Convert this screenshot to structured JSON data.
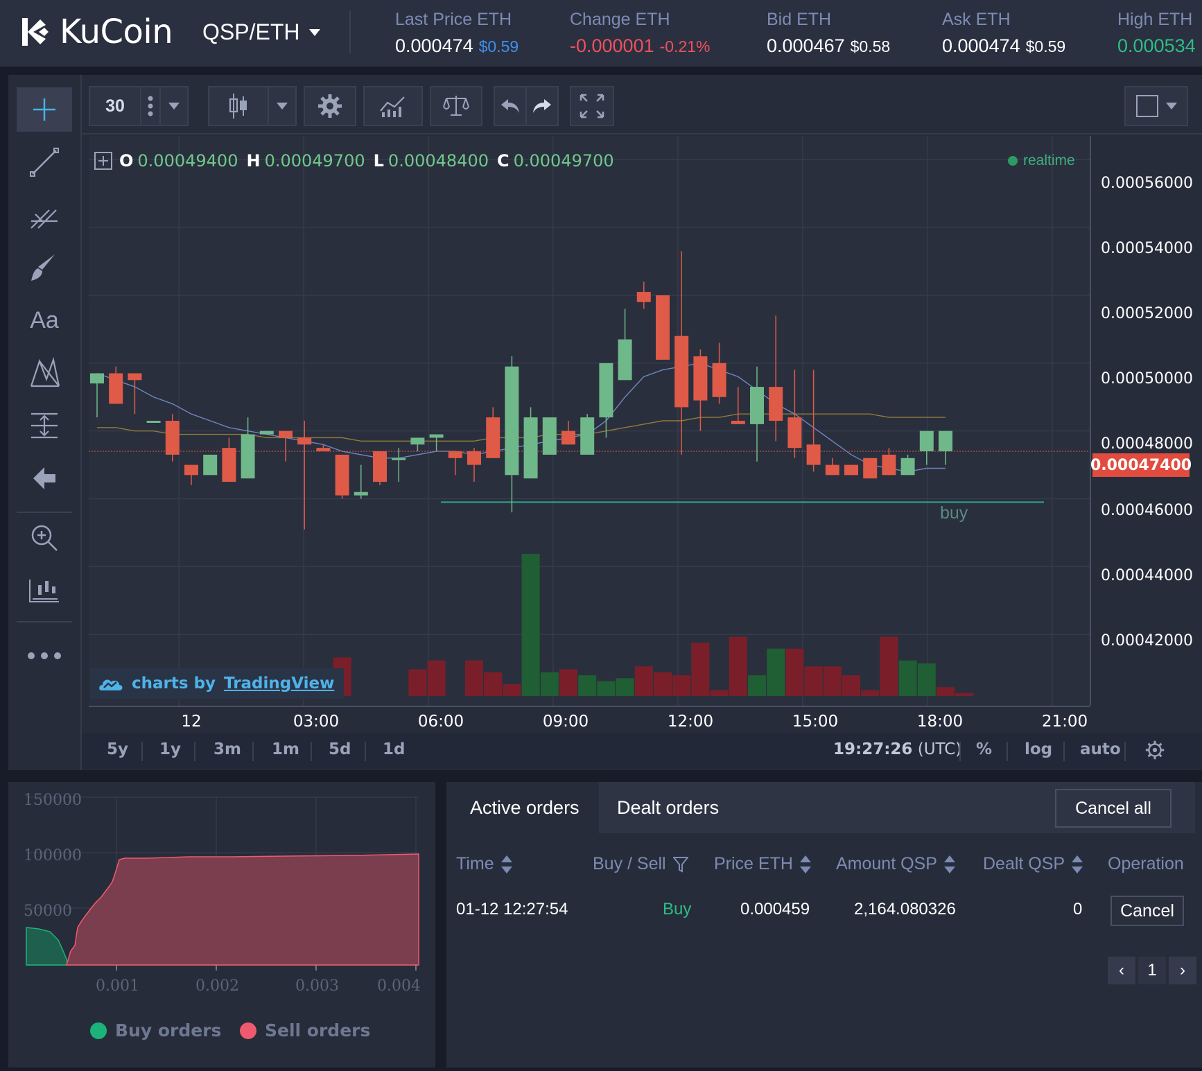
{
  "header": {
    "logo_text": "KuCoin",
    "pair": "QSP/ETH",
    "stats": [
      {
        "label": "Last Price ETH",
        "value": "0.000474",
        "usd": "$0.59",
        "value_color": "#ffffff",
        "usd_color": "#3f8ff0"
      },
      {
        "label": "Change ETH",
        "value": "-0.000001",
        "usd": "-0.21%",
        "value_color": "#f0505c",
        "usd_color": "#f0505c"
      },
      {
        "label": "Bid ETH",
        "value": "0.000467",
        "usd": "$0.58",
        "value_color": "#ffffff",
        "usd_color": "#ffffff"
      },
      {
        "label": "Ask ETH",
        "value": "0.000474",
        "usd": "$0.59",
        "value_color": "#ffffff",
        "usd_color": "#ffffff"
      },
      {
        "label": "High ETH",
        "value": "0.000534",
        "usd": "",
        "value_color": "#2dbd85",
        "usd_color": "#2dbd85"
      }
    ]
  },
  "toolbar": {
    "interval": "30",
    "left_tools": [
      "crosshair-icon",
      "trend-line-icon",
      "fib-icon",
      "brush-icon",
      "text-icon",
      "pattern-icon",
      "measure-icon",
      "arrow-left-icon",
      "zoom-icon",
      "chart-bars-icon",
      "more-icon"
    ],
    "text_tool_label": "Aa"
  },
  "chart": {
    "ohlc": {
      "o_label": "O",
      "o": "0.00049400",
      "h_label": "H",
      "h": "0.00049700",
      "l_label": "L",
      "l": "0.00048400",
      "c_label": "C",
      "c": "0.00049700"
    },
    "realtime_label": "realtime",
    "tv_badge": {
      "prefix": "charts by",
      "link": "TradingView"
    },
    "buy_label": "buy",
    "current_price_label": "0.00047400",
    "price_ticks": [
      "0.00056000",
      "0.00054000",
      "0.00052000",
      "0.00050000",
      "0.00048000",
      "0.00046000",
      "0.00044000",
      "0.00042000"
    ],
    "time_ticks": [
      "12",
      "03:00",
      "06:00",
      "09:00",
      "12:00",
      "15:00",
      "18:00",
      "21:00"
    ],
    "colors": {
      "up": "#6fb88a",
      "down": "#e05a48",
      "vol_up": "#1f5f33",
      "vol_down": "#7a1f2a",
      "ma_fast": "#6f86c2",
      "ma_slow": "#8f7c3a"
    }
  },
  "chart_data": {
    "type": "candlestick",
    "title": "",
    "x": [
      "12",
      "03:00",
      "06:00",
      "09:00",
      "12:00",
      "15:00",
      "18:00",
      "21:00"
    ],
    "ylim": [
      0.0004,
      0.00057
    ],
    "candles": [
      [
        0.000494,
        0.000497,
        0.000484,
        0.000497
      ],
      [
        0.000497,
        0.000499,
        0.000488,
        0.000488
      ],
      [
        0.000497,
        0.000497,
        0.000485,
        0.000495
      ],
      [
        0.000483,
        0.000483,
        0.000483,
        0.000483
      ],
      [
        0.000483,
        0.000485,
        0.000471,
        0.000473
      ],
      [
        0.00047,
        0.00047,
        0.000464,
        0.000467
      ],
      [
        0.000467,
        0.000473,
        0.000467,
        0.000473
      ],
      [
        0.000475,
        0.000478,
        0.000465,
        0.000465
      ],
      [
        0.000466,
        0.000484,
        0.000466,
        0.000479
      ],
      [
        0.000479,
        0.00048,
        0.000479,
        0.00048
      ],
      [
        0.00048,
        0.00048,
        0.000471,
        0.000478
      ],
      [
        0.000478,
        0.000483,
        0.000451,
        0.000476
      ],
      [
        0.000475,
        0.000476,
        0.000474,
        0.000474
      ],
      [
        0.000473,
        0.000473,
        0.00046,
        0.000461
      ],
      [
        0.000461,
        0.00047,
        0.00046,
        0.000462
      ],
      [
        0.000474,
        0.000474,
        0.000464,
        0.000465
      ],
      [
        0.000472,
        0.000475,
        0.000465,
        0.000472
      ],
      [
        0.000476,
        0.000478,
        0.000474,
        0.000478
      ],
      [
        0.000478,
        0.000478,
        0.000474,
        0.000479
      ],
      [
        0.000474,
        0.000474,
        0.000467,
        0.000472
      ],
      [
        0.000474,
        0.000475,
        0.000465,
        0.00047
      ],
      [
        0.000484,
        0.000487,
        0.000472,
        0.000472
      ],
      [
        0.000467,
        0.000502,
        0.000456,
        0.000499
      ],
      [
        0.000466,
        0.000487,
        0.000466,
        0.000484
      ],
      [
        0.000473,
        0.000484,
        0.000473,
        0.000484
      ],
      [
        0.00048,
        0.000483,
        0.000476,
        0.000476
      ],
      [
        0.000473,
        0.000485,
        0.000473,
        0.000484
      ],
      [
        0.000484,
        0.000491,
        0.000478,
        0.0005
      ],
      [
        0.000495,
        0.000516,
        0.000495,
        0.000507
      ],
      [
        0.000521,
        0.000524,
        0.000516,
        0.000518
      ],
      [
        0.00052,
        0.00052,
        0.000501,
        0.000501
      ],
      [
        0.000508,
        0.000533,
        0.000473,
        0.000487
      ],
      [
        0.000502,
        0.000504,
        0.00048,
        0.000489
      ],
      [
        0.0005,
        0.000506,
        0.000488,
        0.00049
      ],
      [
        0.000483,
        0.000493,
        0.000482,
        0.000482
      ],
      [
        0.000482,
        0.000499,
        0.000471,
        0.000493
      ],
      [
        0.000493,
        0.000514,
        0.000477,
        0.000483
      ],
      [
        0.000484,
        0.000498,
        0.000472,
        0.000475
      ],
      [
        0.000476,
        0.000498,
        0.000468,
        0.00047
      ],
      [
        0.00047,
        0.000472,
        0.000467,
        0.000467
      ],
      [
        0.00047,
        0.00047,
        0.000467,
        0.000467
      ],
      [
        0.000472,
        0.000472,
        0.000466,
        0.000466
      ],
      [
        0.000473,
        0.000475,
        0.000467,
        0.000467
      ],
      [
        0.000467,
        0.000473,
        0.000467,
        0.000472
      ],
      [
        0.000474,
        0.00048,
        0.00047,
        0.00048
      ],
      [
        0.000474,
        0.00048,
        0.00047,
        0.00048
      ]
    ],
    "volume": [
      0,
      6,
      0,
      0,
      0,
      4,
      5,
      7,
      5,
      0,
      0,
      0,
      0,
      13,
      0,
      0,
      0,
      9,
      12,
      0,
      12,
      8,
      4,
      48,
      8,
      9,
      7,
      5,
      6,
      10,
      8,
      7,
      18,
      2,
      20,
      7,
      16,
      16,
      10,
      10,
      7,
      2,
      20,
      12,
      11,
      3,
      1
    ],
    "volume_up": [
      0,
      0,
      0,
      0,
      0,
      0,
      0,
      0,
      0,
      0,
      0,
      0,
      0,
      0,
      0,
      0,
      0,
      0,
      0,
      0,
      0,
      0,
      0,
      1,
      1,
      0,
      1,
      1,
      1,
      0,
      0,
      0,
      0,
      0,
      0,
      1,
      1,
      0,
      0,
      0,
      0,
      0,
      0,
      1,
      1,
      0,
      0
    ],
    "ma_fast": [
      0.000497,
      0.000495,
      0.000493,
      0.00049,
      0.000488,
      0.000485,
      0.000483,
      0.000481,
      0.00048,
      0.000479,
      0.000478,
      0.000477,
      0.000476,
      0.000474,
      0.000473,
      0.000472,
      0.000472,
      0.000473,
      0.000474,
      0.000474,
      0.000473,
      0.000474,
      0.000475,
      0.000476,
      0.000477,
      0.000478,
      0.000479,
      0.000483,
      0.00049,
      0.000496,
      0.000498,
      0.000499,
      0.0005,
      0.000498,
      0.000496,
      0.000492,
      0.000488,
      0.000485,
      0.000481,
      0.000477,
      0.000473,
      0.00047,
      0.000469,
      0.000468,
      0.000469,
      0.000469
    ],
    "ma_slow": [
      0.000481,
      0.000481,
      0.00048,
      0.00048,
      0.000479,
      0.000479,
      0.000479,
      0.000479,
      0.000479,
      0.000478,
      0.000478,
      0.000478,
      0.000478,
      0.000478,
      0.000477,
      0.000477,
      0.000477,
      0.000477,
      0.000477,
      0.000477,
      0.000477,
      0.000478,
      0.000478,
      0.000478,
      0.000479,
      0.000479,
      0.000479,
      0.00048,
      0.000481,
      0.000482,
      0.000483,
      0.000483,
      0.000484,
      0.000484,
      0.000485,
      0.000485,
      0.000485,
      0.000485,
      0.000485,
      0.000485,
      0.000485,
      0.000485,
      0.000484,
      0.000484,
      0.000484,
      0.000484
    ],
    "buy_line_price": 0.000459,
    "current_price": 0.000474
  },
  "bottom_bar": {
    "ranges": [
      "5y",
      "1y",
      "3m",
      "1m",
      "5d",
      "1d"
    ],
    "time": "19:27:26",
    "tz": "(UTC)",
    "percent": "%",
    "log": "log",
    "auto": "auto"
  },
  "depth": {
    "y_ticks": [
      "150000",
      "100000",
      "50000"
    ],
    "x_ticks": [
      "0.001",
      "0.002",
      "0.003",
      "0.004"
    ],
    "legend": [
      {
        "label": "Buy orders",
        "color": "#1bb37a"
      },
      {
        "label": "Sell orders",
        "color": "#f05a6e"
      }
    ]
  },
  "orders": {
    "tabs": [
      "Active orders",
      "Dealt orders"
    ],
    "cancel_all": "Cancel all",
    "columns": [
      "Time",
      "Buy / Sell",
      "Price ETH",
      "Amount QSP",
      "Dealt QSP",
      "Operation"
    ],
    "rows": [
      {
        "time": "01-12 12:27:54",
        "side": "Buy",
        "price": "0.000459",
        "amount": "2,164.080326",
        "dealt": "0",
        "operation": "Cancel"
      }
    ],
    "pagination": {
      "prev": "‹",
      "page": "1",
      "next": "›"
    }
  }
}
